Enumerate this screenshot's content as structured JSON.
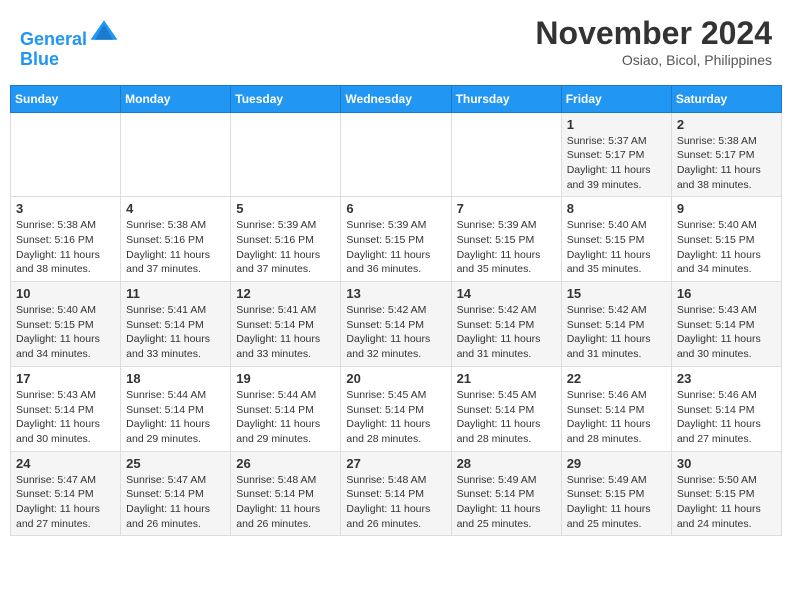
{
  "header": {
    "logo_line1": "General",
    "logo_line2": "Blue",
    "month_title": "November 2024",
    "location": "Osiao, Bicol, Philippines"
  },
  "calendar": {
    "days_of_week": [
      "Sunday",
      "Monday",
      "Tuesday",
      "Wednesday",
      "Thursday",
      "Friday",
      "Saturday"
    ],
    "weeks": [
      [
        {
          "day": "",
          "info": ""
        },
        {
          "day": "",
          "info": ""
        },
        {
          "day": "",
          "info": ""
        },
        {
          "day": "",
          "info": ""
        },
        {
          "day": "",
          "info": ""
        },
        {
          "day": "1",
          "info": "Sunrise: 5:37 AM\nSunset: 5:17 PM\nDaylight: 11 hours and 39 minutes."
        },
        {
          "day": "2",
          "info": "Sunrise: 5:38 AM\nSunset: 5:17 PM\nDaylight: 11 hours and 38 minutes."
        }
      ],
      [
        {
          "day": "3",
          "info": "Sunrise: 5:38 AM\nSunset: 5:16 PM\nDaylight: 11 hours and 38 minutes."
        },
        {
          "day": "4",
          "info": "Sunrise: 5:38 AM\nSunset: 5:16 PM\nDaylight: 11 hours and 37 minutes."
        },
        {
          "day": "5",
          "info": "Sunrise: 5:39 AM\nSunset: 5:16 PM\nDaylight: 11 hours and 37 minutes."
        },
        {
          "day": "6",
          "info": "Sunrise: 5:39 AM\nSunset: 5:15 PM\nDaylight: 11 hours and 36 minutes."
        },
        {
          "day": "7",
          "info": "Sunrise: 5:39 AM\nSunset: 5:15 PM\nDaylight: 11 hours and 35 minutes."
        },
        {
          "day": "8",
          "info": "Sunrise: 5:40 AM\nSunset: 5:15 PM\nDaylight: 11 hours and 35 minutes."
        },
        {
          "day": "9",
          "info": "Sunrise: 5:40 AM\nSunset: 5:15 PM\nDaylight: 11 hours and 34 minutes."
        }
      ],
      [
        {
          "day": "10",
          "info": "Sunrise: 5:40 AM\nSunset: 5:15 PM\nDaylight: 11 hours and 34 minutes."
        },
        {
          "day": "11",
          "info": "Sunrise: 5:41 AM\nSunset: 5:14 PM\nDaylight: 11 hours and 33 minutes."
        },
        {
          "day": "12",
          "info": "Sunrise: 5:41 AM\nSunset: 5:14 PM\nDaylight: 11 hours and 33 minutes."
        },
        {
          "day": "13",
          "info": "Sunrise: 5:42 AM\nSunset: 5:14 PM\nDaylight: 11 hours and 32 minutes."
        },
        {
          "day": "14",
          "info": "Sunrise: 5:42 AM\nSunset: 5:14 PM\nDaylight: 11 hours and 31 minutes."
        },
        {
          "day": "15",
          "info": "Sunrise: 5:42 AM\nSunset: 5:14 PM\nDaylight: 11 hours and 31 minutes."
        },
        {
          "day": "16",
          "info": "Sunrise: 5:43 AM\nSunset: 5:14 PM\nDaylight: 11 hours and 30 minutes."
        }
      ],
      [
        {
          "day": "17",
          "info": "Sunrise: 5:43 AM\nSunset: 5:14 PM\nDaylight: 11 hours and 30 minutes."
        },
        {
          "day": "18",
          "info": "Sunrise: 5:44 AM\nSunset: 5:14 PM\nDaylight: 11 hours and 29 minutes."
        },
        {
          "day": "19",
          "info": "Sunrise: 5:44 AM\nSunset: 5:14 PM\nDaylight: 11 hours and 29 minutes."
        },
        {
          "day": "20",
          "info": "Sunrise: 5:45 AM\nSunset: 5:14 PM\nDaylight: 11 hours and 28 minutes."
        },
        {
          "day": "21",
          "info": "Sunrise: 5:45 AM\nSunset: 5:14 PM\nDaylight: 11 hours and 28 minutes."
        },
        {
          "day": "22",
          "info": "Sunrise: 5:46 AM\nSunset: 5:14 PM\nDaylight: 11 hours and 28 minutes."
        },
        {
          "day": "23",
          "info": "Sunrise: 5:46 AM\nSunset: 5:14 PM\nDaylight: 11 hours and 27 minutes."
        }
      ],
      [
        {
          "day": "24",
          "info": "Sunrise: 5:47 AM\nSunset: 5:14 PM\nDaylight: 11 hours and 27 minutes."
        },
        {
          "day": "25",
          "info": "Sunrise: 5:47 AM\nSunset: 5:14 PM\nDaylight: 11 hours and 26 minutes."
        },
        {
          "day": "26",
          "info": "Sunrise: 5:48 AM\nSunset: 5:14 PM\nDaylight: 11 hours and 26 minutes."
        },
        {
          "day": "27",
          "info": "Sunrise: 5:48 AM\nSunset: 5:14 PM\nDaylight: 11 hours and 26 minutes."
        },
        {
          "day": "28",
          "info": "Sunrise: 5:49 AM\nSunset: 5:14 PM\nDaylight: 11 hours and 25 minutes."
        },
        {
          "day": "29",
          "info": "Sunrise: 5:49 AM\nSunset: 5:15 PM\nDaylight: 11 hours and 25 minutes."
        },
        {
          "day": "30",
          "info": "Sunrise: 5:50 AM\nSunset: 5:15 PM\nDaylight: 11 hours and 24 minutes."
        }
      ]
    ]
  }
}
